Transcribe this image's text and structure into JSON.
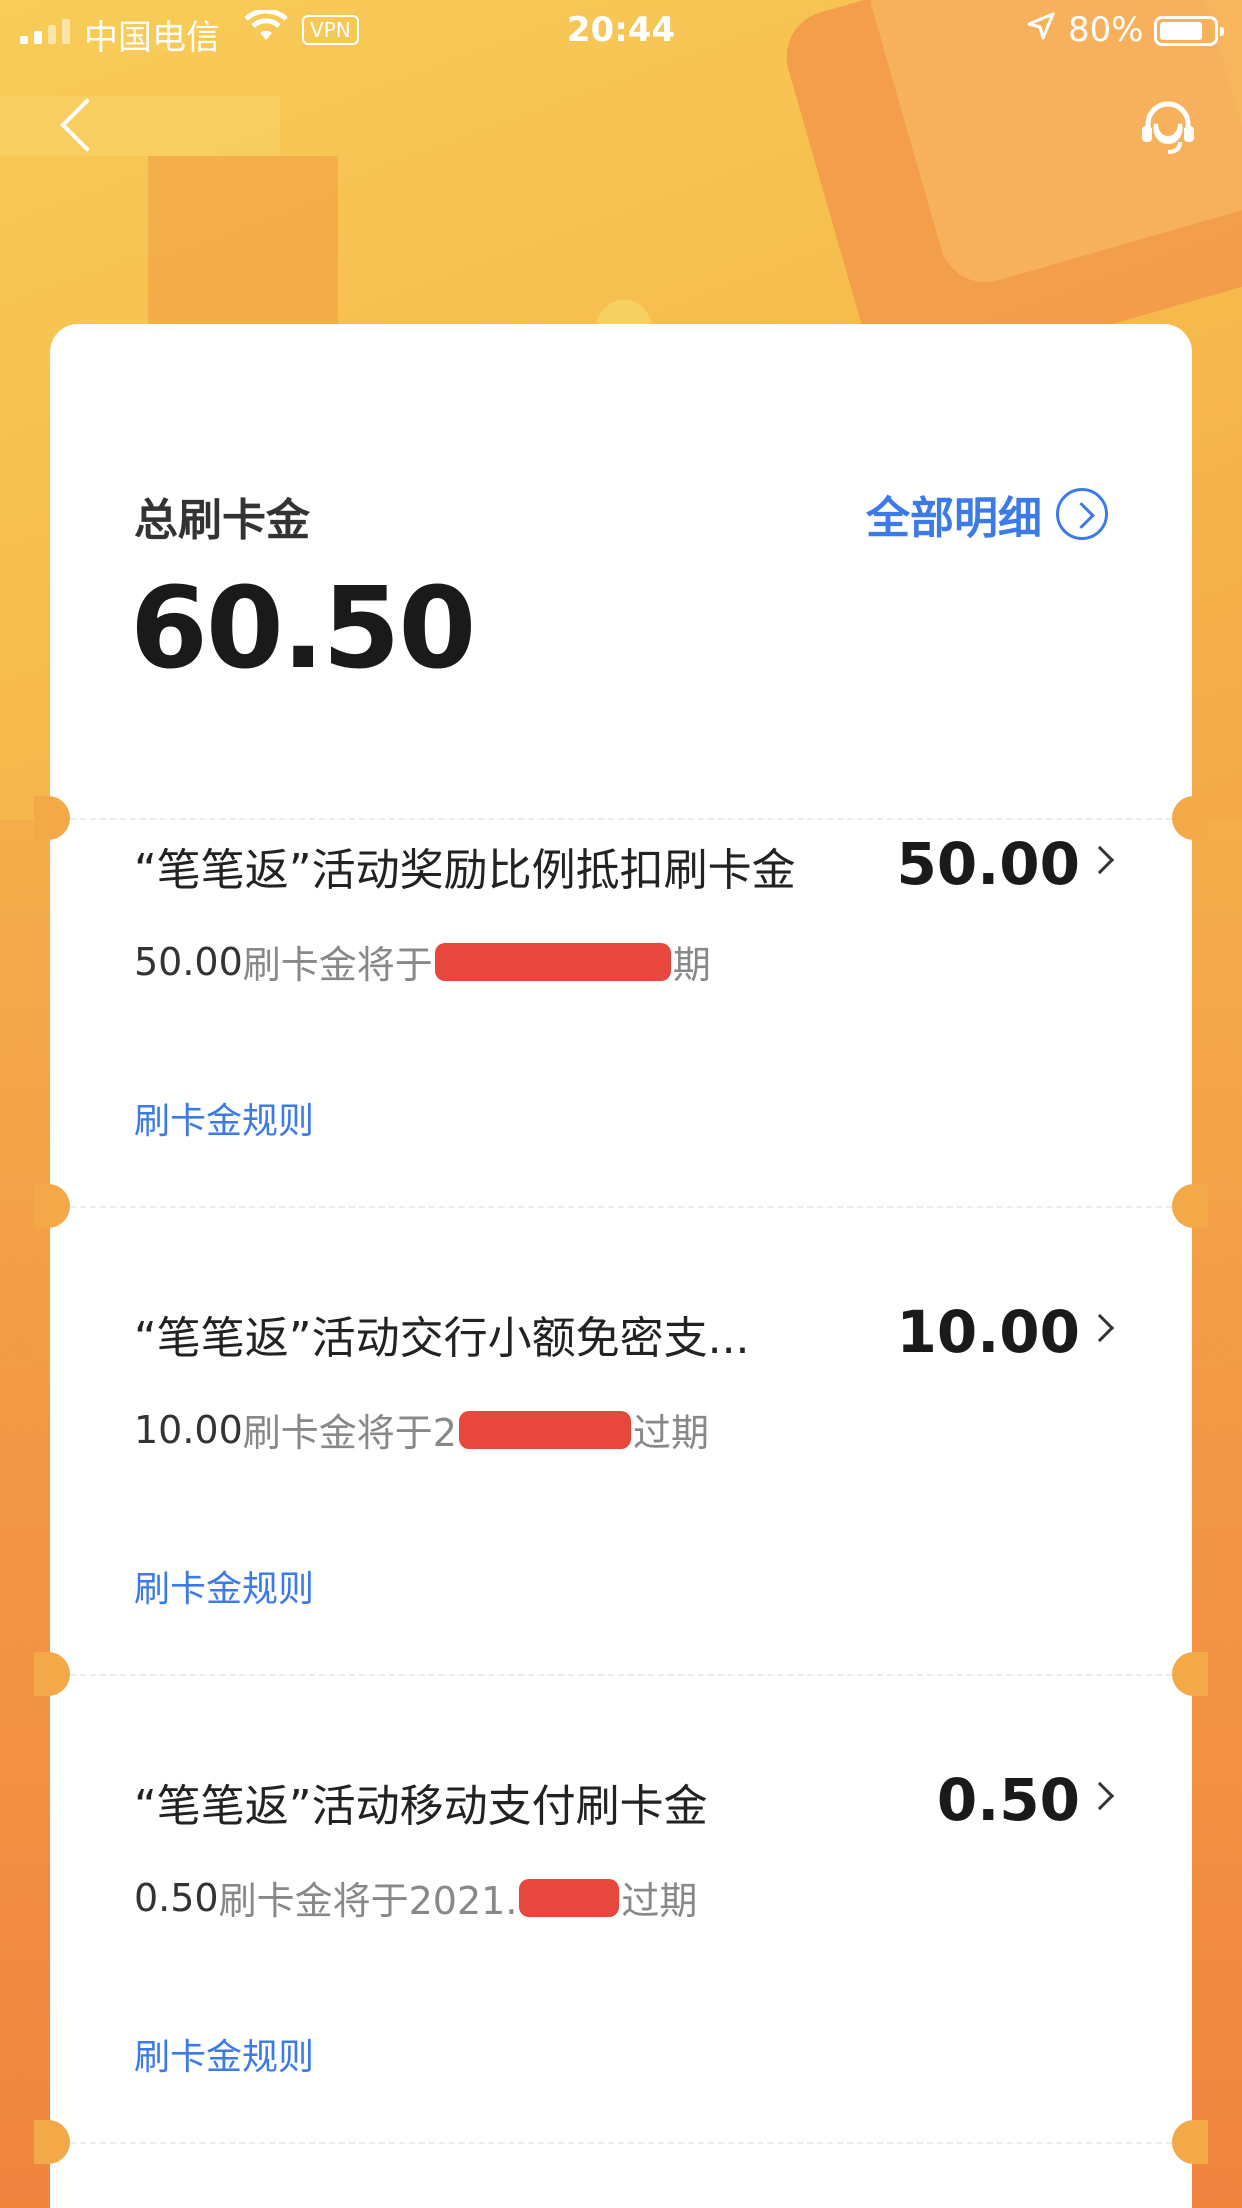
{
  "status_bar": {
    "carrier": "中国电信",
    "vpn": "VPN",
    "time": "20:44",
    "battery": "80%"
  },
  "summary": {
    "title": "总刷卡金",
    "total": "60.50",
    "detail_link": "全部明细"
  },
  "items": [
    {
      "title": "“笔笔返”活动奖励比例抵扣刷卡金",
      "amount": "50.00",
      "expire_amount": "50.00",
      "expire_prefix": "刷卡金将于",
      "expire_suffix": "期",
      "rule": "刷卡金规则"
    },
    {
      "title": "“笔笔返”活动交行小额免密支...",
      "amount": "10.00",
      "expire_amount": "10.00",
      "expire_prefix": "刷卡金将于2",
      "expire_suffix": "过期",
      "rule": "刷卡金规则"
    },
    {
      "title": "“笔笔返”活动移动支付刷卡金",
      "amount": "0.50",
      "expire_amount": "0.50",
      "expire_prefix": "刷卡金将于2021.",
      "expire_suffix": "过期",
      "rule": "刷卡金规则"
    }
  ],
  "colors": {
    "accent": "#3c7ae8",
    "redaction": "#e8473d",
    "background_top": "#f7c04f",
    "background_bottom": "#f0843f"
  }
}
